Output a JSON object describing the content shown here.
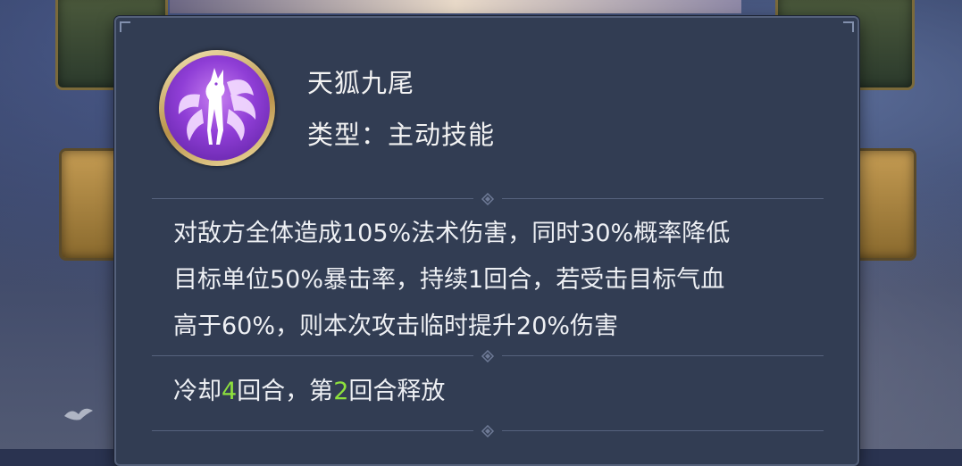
{
  "skill": {
    "name": "天狐九尾",
    "type_label": "类型：",
    "type_value": "主动技能",
    "icon": "nine-tailed-fox-icon",
    "icon_colors": {
      "ring": "#d8b56c",
      "inner": "#8f3ed6"
    }
  },
  "description": {
    "lines": [
      "对敌方全体造成105%法术伤害，同时30%概率降低",
      "目标单位50%暴击率，持续1回合，若受击目标气血",
      "高于60%，则本次攻击临时提升20%伤害"
    ]
  },
  "cooldown": {
    "prefix": "冷却",
    "turns": "4",
    "mid": "回合，第",
    "release_turn": "2",
    "suffix": "回合释放",
    "highlight_color": "#8ee13d"
  }
}
